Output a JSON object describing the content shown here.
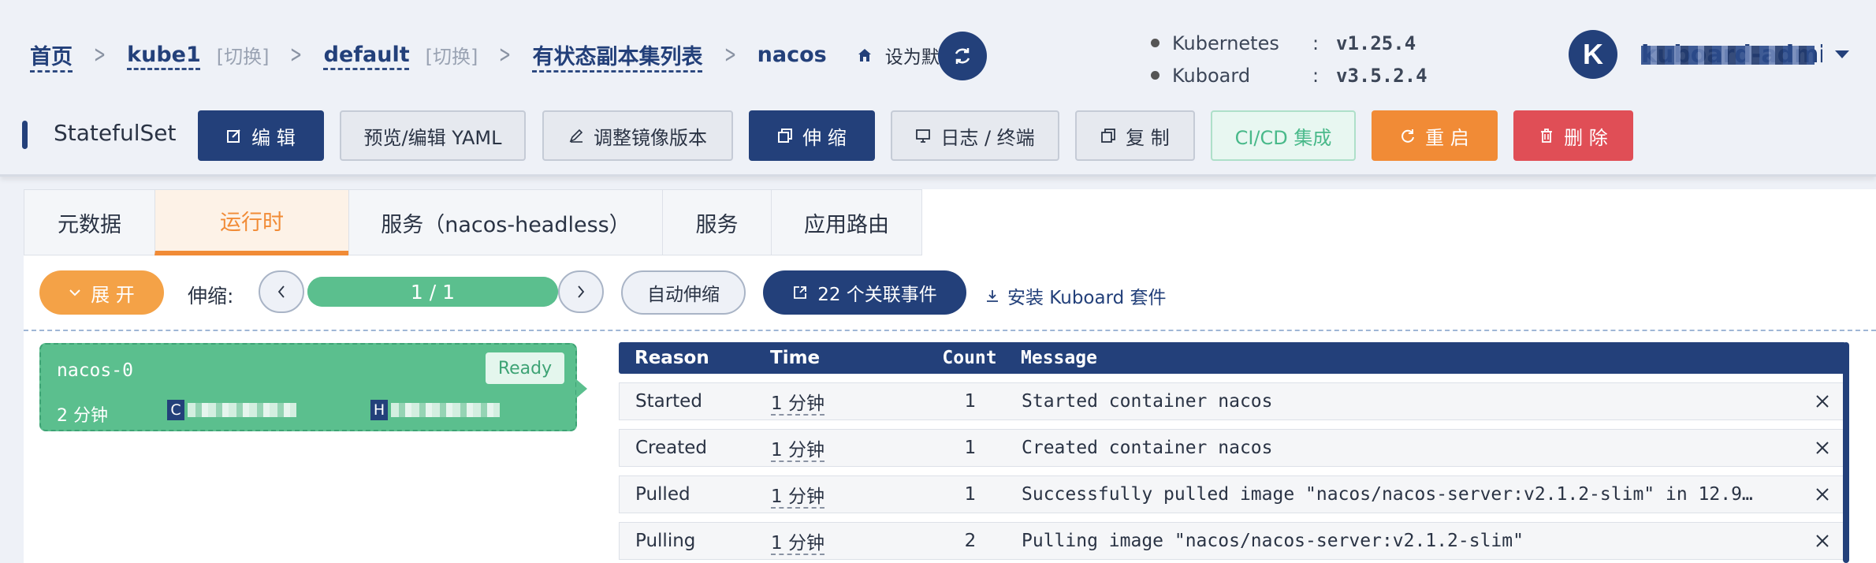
{
  "breadcrumb": {
    "home": "首页",
    "cluster": "kube1",
    "cluster_switch": "[切换]",
    "namespace": "default",
    "namespace_switch": "[切换]",
    "list": "有状态副本集列表",
    "current": "nacos",
    "set_default": "设为默认页"
  },
  "versions": [
    {
      "label": "Kubernetes",
      "colon": ":",
      "value": "v1.25.4"
    },
    {
      "label": "Kuboard",
      "colon": ":",
      "value": "v3.5.2.4"
    }
  ],
  "user": {
    "avatar_letter": "K",
    "name": "kuboard-admin"
  },
  "toolbar": {
    "title": "StatefulSet",
    "edit": "编 辑",
    "yaml": "预览/编辑 YAML",
    "image": "调整镜像版本",
    "scale": "伸 缩",
    "logs": "日志 / 终端",
    "copy": "复 制",
    "cicd": "CI/CD 集成",
    "restart": "重 启",
    "delete": "删 除"
  },
  "tabs": [
    "元数据",
    "运行时",
    "服务（nacos-headless）",
    "服务",
    "应用路由"
  ],
  "controls": {
    "expand": "展 开",
    "scale_label": "伸缩:",
    "progress_text": "1 / 1",
    "progress_fraction": 1.0,
    "auto_scale": "自动伸缩",
    "events": "22 个关联事件",
    "install": "安装 Kuboard 套件"
  },
  "pod": {
    "name": "nacos-0",
    "status": "Ready",
    "age": "2 分钟",
    "container_tag": "C",
    "host_tag": "H"
  },
  "events_table": {
    "headers": {
      "reason": "Reason",
      "time": "Time",
      "count": "Count",
      "message": "Message"
    },
    "rows": [
      {
        "reason": "Started",
        "time": "1 分钟",
        "count": "1",
        "message": "Started container nacos"
      },
      {
        "reason": "Created",
        "time": "1 分钟",
        "count": "1",
        "message": "Created container nacos"
      },
      {
        "reason": "Pulled",
        "time": "1 分钟",
        "count": "1",
        "message": "Successfully pulled image \"nacos/nacos-server:v2.1.2-slim\" in 12.9…"
      },
      {
        "reason": "Pulling",
        "time": "1 分钟",
        "count": "2",
        "message": "Pulling image \"nacos/nacos-server:v2.1.2-slim\""
      }
    ]
  },
  "colors": {
    "primary": "#23407a",
    "orange": "#f18b36",
    "green": "#5bbf8e",
    "red": "#e04e56"
  }
}
